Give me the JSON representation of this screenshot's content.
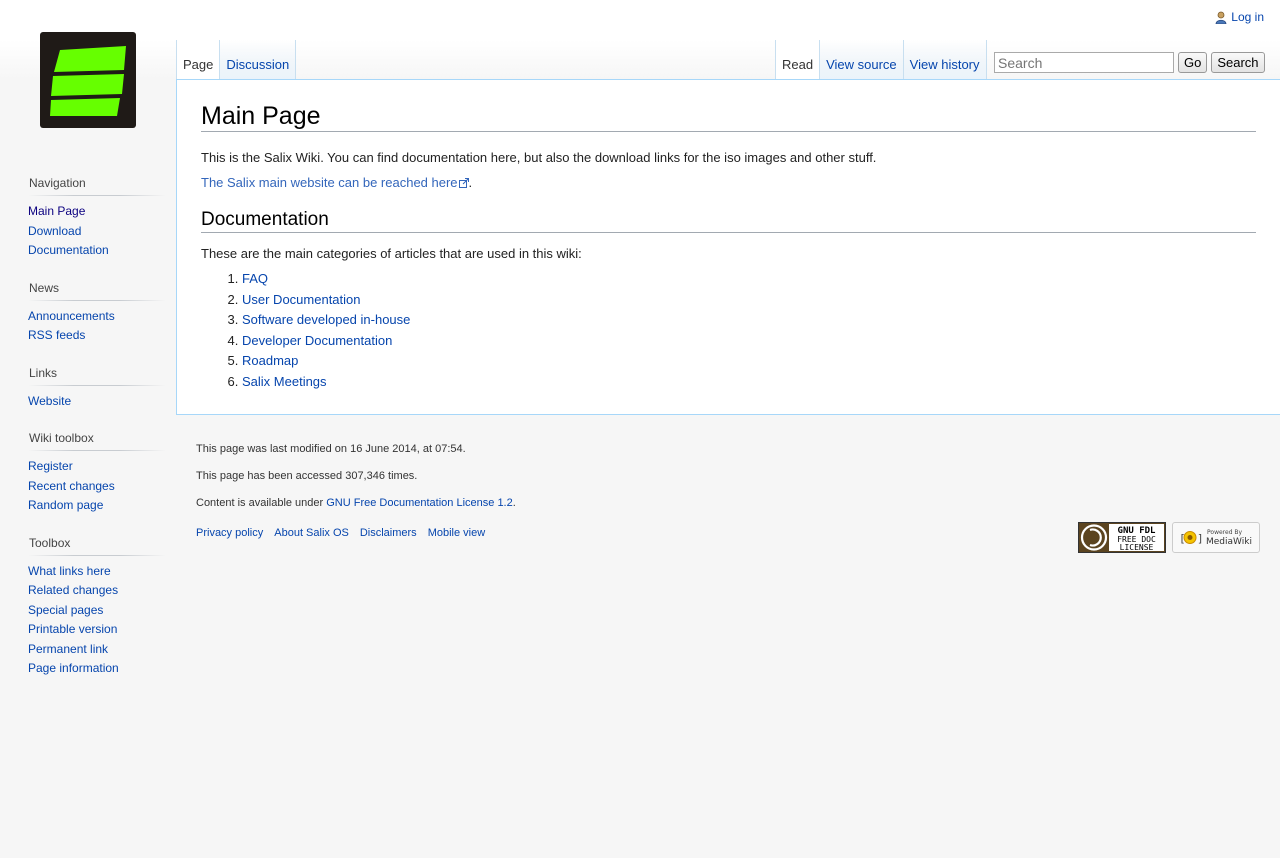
{
  "personal": {
    "login_label": "Log in"
  },
  "tabs": {
    "left": [
      {
        "label": "Page"
      },
      {
        "label": "Discussion"
      }
    ],
    "right": [
      {
        "label": "Read"
      },
      {
        "label": "View source"
      },
      {
        "label": "View history"
      }
    ]
  },
  "search": {
    "placeholder": "Search",
    "go_label": "Go",
    "search_label": "Search"
  },
  "content": {
    "title": "Main Page",
    "intro": "This is the Salix Wiki. You can find documentation here, but also the download links for the iso images and other stuff.",
    "website_link": "The Salix main website can be reached here",
    "website_link_suffix": ".",
    "section_title": "Documentation",
    "section_intro": "These are the main categories of articles that are used in this wiki:",
    "categories": [
      "FAQ",
      "User Documentation",
      "Software developed in-house",
      "Developer Documentation",
      "Roadmap",
      "Salix Meetings"
    ]
  },
  "sidebar": {
    "portals": [
      {
        "title": "Navigation",
        "items": [
          "Main Page",
          "Download",
          "Documentation"
        ]
      },
      {
        "title": "News",
        "items": [
          "Announcements",
          "RSS feeds"
        ]
      },
      {
        "title": "Links",
        "items": [
          "Website"
        ]
      },
      {
        "title": "Wiki toolbox",
        "items": [
          "Register",
          "Recent changes",
          "Random page"
        ]
      },
      {
        "title": "Toolbox",
        "items": [
          "What links here",
          "Related changes",
          "Special pages",
          "Printable version",
          "Permanent link",
          "Page information"
        ]
      }
    ]
  },
  "footer": {
    "last_modified": "This page was last modified on 16 June 2014, at 07:54.",
    "accessed": "This page has been accessed 307,346 times.",
    "license_prefix": "Content is available under ",
    "license_link": "GNU Free Documentation License 1.2",
    "license_suffix": ".",
    "places": [
      "Privacy policy",
      "About Salix OS",
      "Disclaimers",
      "Mobile view"
    ],
    "gfdl_badge": {
      "line1": "GNU FDL",
      "line2": "FREE DOC",
      "line3": "LICENSE"
    },
    "mw_badge": {
      "line1": "Powered By",
      "line2": "MediaWiki"
    }
  },
  "colors": {
    "logo_bg": "#1f1a17",
    "logo_green": "#66ff00",
    "link": "#0645ad",
    "border": "#a7d7f9"
  }
}
